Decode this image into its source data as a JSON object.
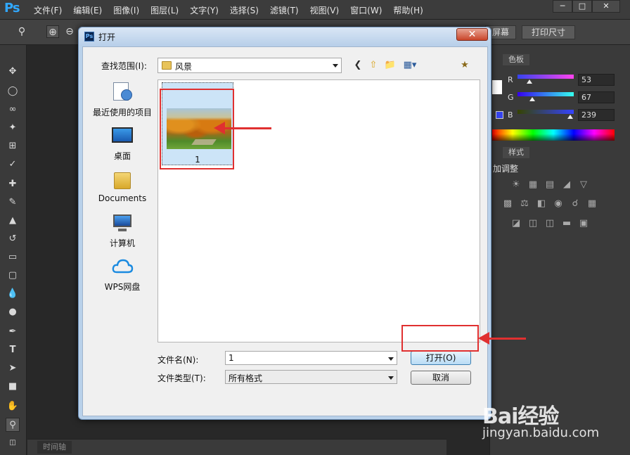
{
  "app": {
    "logo": "Ps",
    "menus": [
      "文件(F)",
      "编辑(E)",
      "图像(I)",
      "图层(L)",
      "文字(Y)",
      "选择(S)",
      "滤镜(T)",
      "视图(V)",
      "窗口(W)",
      "帮助(H)"
    ],
    "window_controls": [
      "─",
      "□",
      "✕"
    ]
  },
  "options_bar": {
    "fill_screen_label": "屏幕",
    "print_size_label": "打印尺寸"
  },
  "tools": [
    "move",
    "marquee",
    "lasso",
    "magic-wand",
    "crop",
    "eyedropper",
    "healing-brush",
    "brush",
    "clone-stamp",
    "history-brush",
    "eraser",
    "gradient",
    "blur",
    "dodge",
    "pen",
    "type",
    "path-selection",
    "shape",
    "hand",
    "zoom"
  ],
  "timeline": {
    "tab_label": "时间轴"
  },
  "color_panel": {
    "tab_label": "色板",
    "channels": [
      {
        "label": "R",
        "value": "53",
        "fraction": 0.21
      },
      {
        "label": "G",
        "value": "67",
        "fraction": 0.26
      },
      {
        "label": "B",
        "value": "239",
        "fraction": 0.94
      }
    ]
  },
  "adjustments_panel": {
    "tab_label": "样式",
    "title": "加调整"
  },
  "dialog": {
    "title": "打开",
    "lookin_label": "查找范围(I):",
    "lookin_value": "风景",
    "places": [
      {
        "label": "最近使用的项目",
        "icon": "recent-items-icon"
      },
      {
        "label": "桌面",
        "icon": "desktop-icon"
      },
      {
        "label": "Documents",
        "icon": "documents-folder-icon"
      },
      {
        "label": "计算机",
        "icon": "computer-icon"
      },
      {
        "label": "WPS网盘",
        "icon": "cloud-drive-icon"
      }
    ],
    "files": [
      {
        "name": "1",
        "thumbnail": "autumn-landscape"
      }
    ],
    "filename_label": "文件名(N):",
    "filename_value": "1",
    "filetype_label": "文件类型(T):",
    "filetype_value": "所有格式",
    "open_label": "打开(O)",
    "cancel_label": "取消"
  },
  "watermark": {
    "brand": "Bai经验",
    "url": "jingyan.baidu.com"
  },
  "colors": {
    "highlight": "#e03030",
    "ps_blue": "#31a8ff",
    "dialog_frame": "#b9d1ea"
  }
}
